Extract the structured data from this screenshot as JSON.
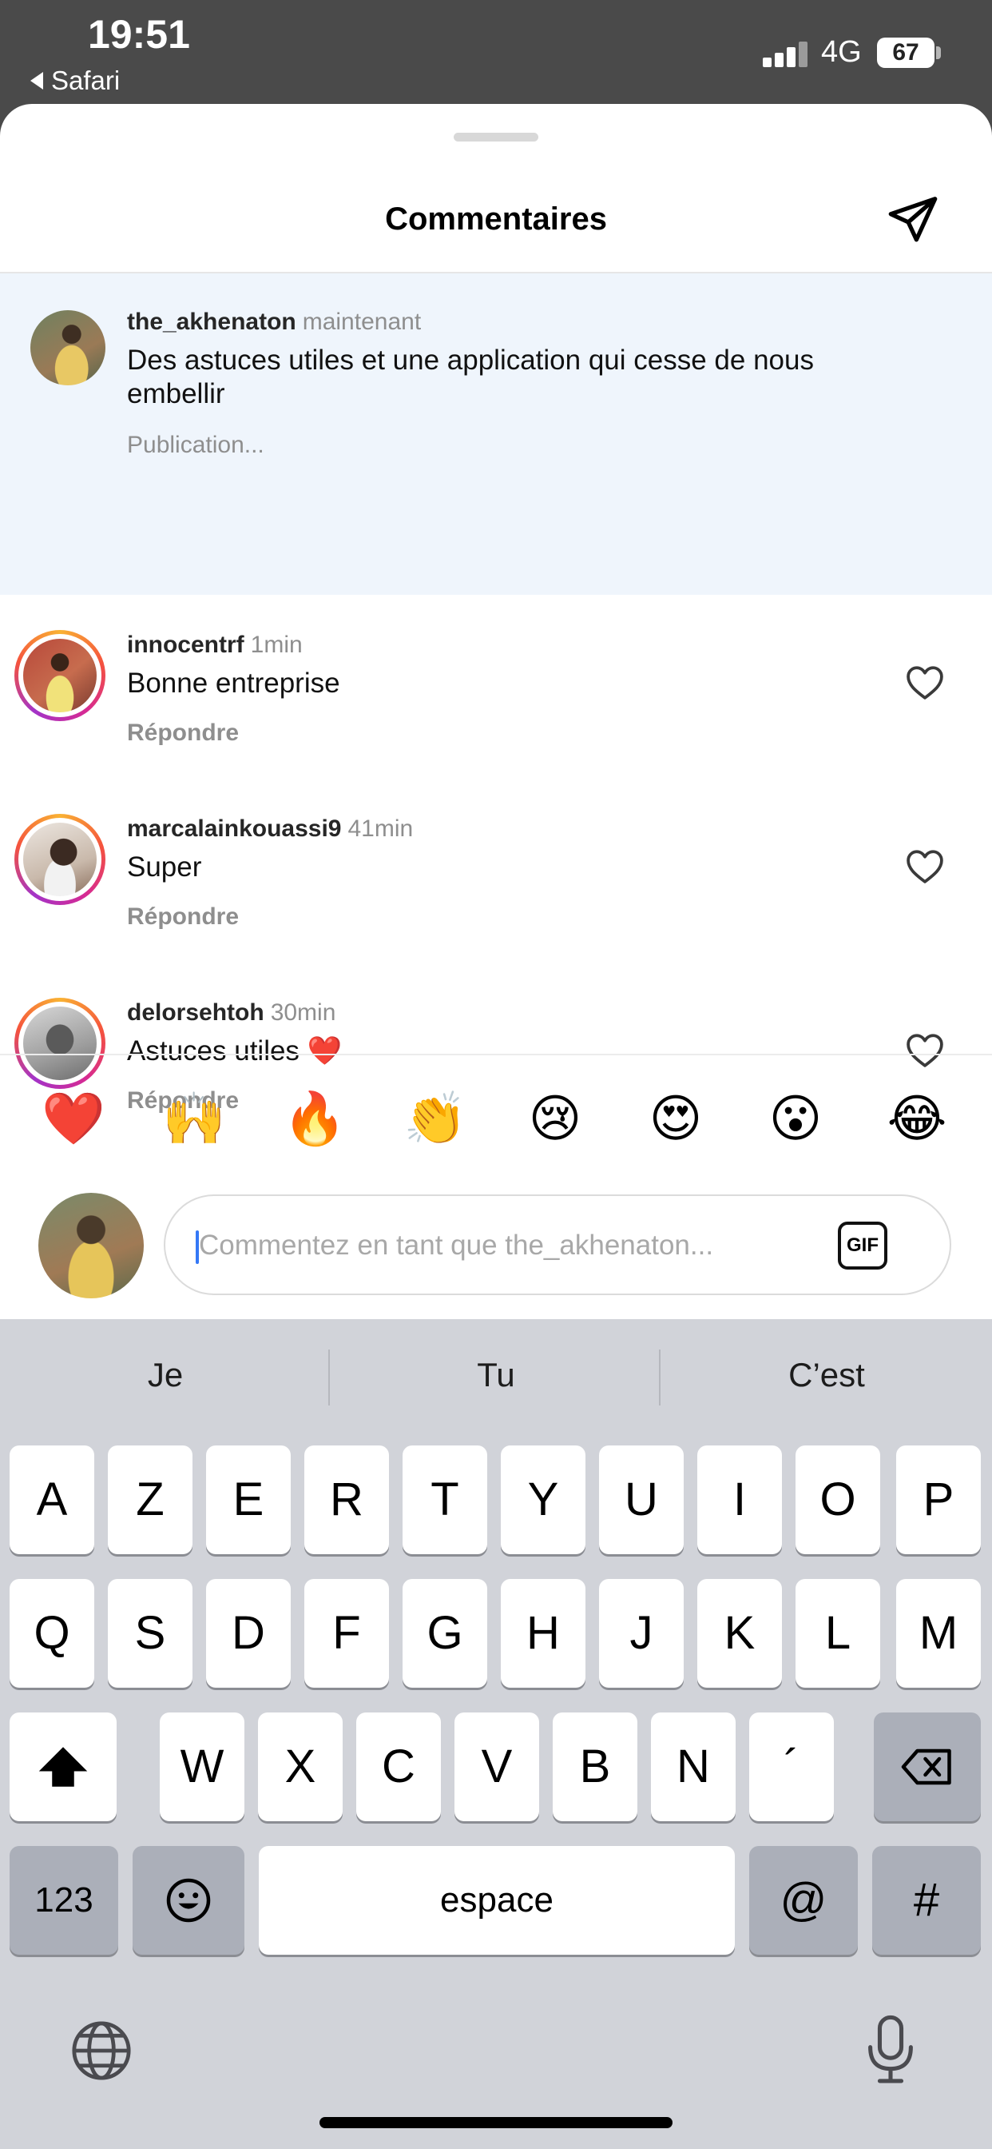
{
  "status_bar": {
    "time": "19:51",
    "back_app": "Safari",
    "network": "4G",
    "battery": "67"
  },
  "sheet": {
    "title": "Commentaires"
  },
  "comments": [
    {
      "username": "the_akhenaton",
      "time": "maintenant",
      "text": "Des astuces utiles et une application qui cesse de nous embellir",
      "status": "Publication..."
    },
    {
      "username": "innocentrf",
      "time": "1min",
      "text": "Bonne entreprise",
      "reply_label": "Répondre"
    },
    {
      "username": "marcalainkouassi9",
      "time": "41min",
      "text": "Super",
      "reply_label": "Répondre"
    },
    {
      "username": "delorsehtoh",
      "time": "30min",
      "text": "Astuces utiles ❤️",
      "reply_label": "Répondre"
    }
  ],
  "emoji_bar": [
    "❤️",
    "🙌",
    "🔥",
    "👏",
    "😢",
    "😍",
    "😮",
    "😂"
  ],
  "composer": {
    "placeholder": "Commentez en tant que the_akhenaton...",
    "gif_label": "GIF"
  },
  "keyboard": {
    "suggestions": [
      "Je",
      "Tu",
      "C’est"
    ],
    "row1": [
      "A",
      "Z",
      "E",
      "R",
      "T",
      "Y",
      "U",
      "I",
      "O",
      "P"
    ],
    "row2": [
      "Q",
      "S",
      "D",
      "F",
      "G",
      "H",
      "J",
      "K",
      "L",
      "M"
    ],
    "row3": [
      "W",
      "X",
      "C",
      "V",
      "B",
      "N",
      "´"
    ],
    "numbers_key": "123",
    "space_key": "espace",
    "at_key": "@",
    "hash_key": "#"
  }
}
